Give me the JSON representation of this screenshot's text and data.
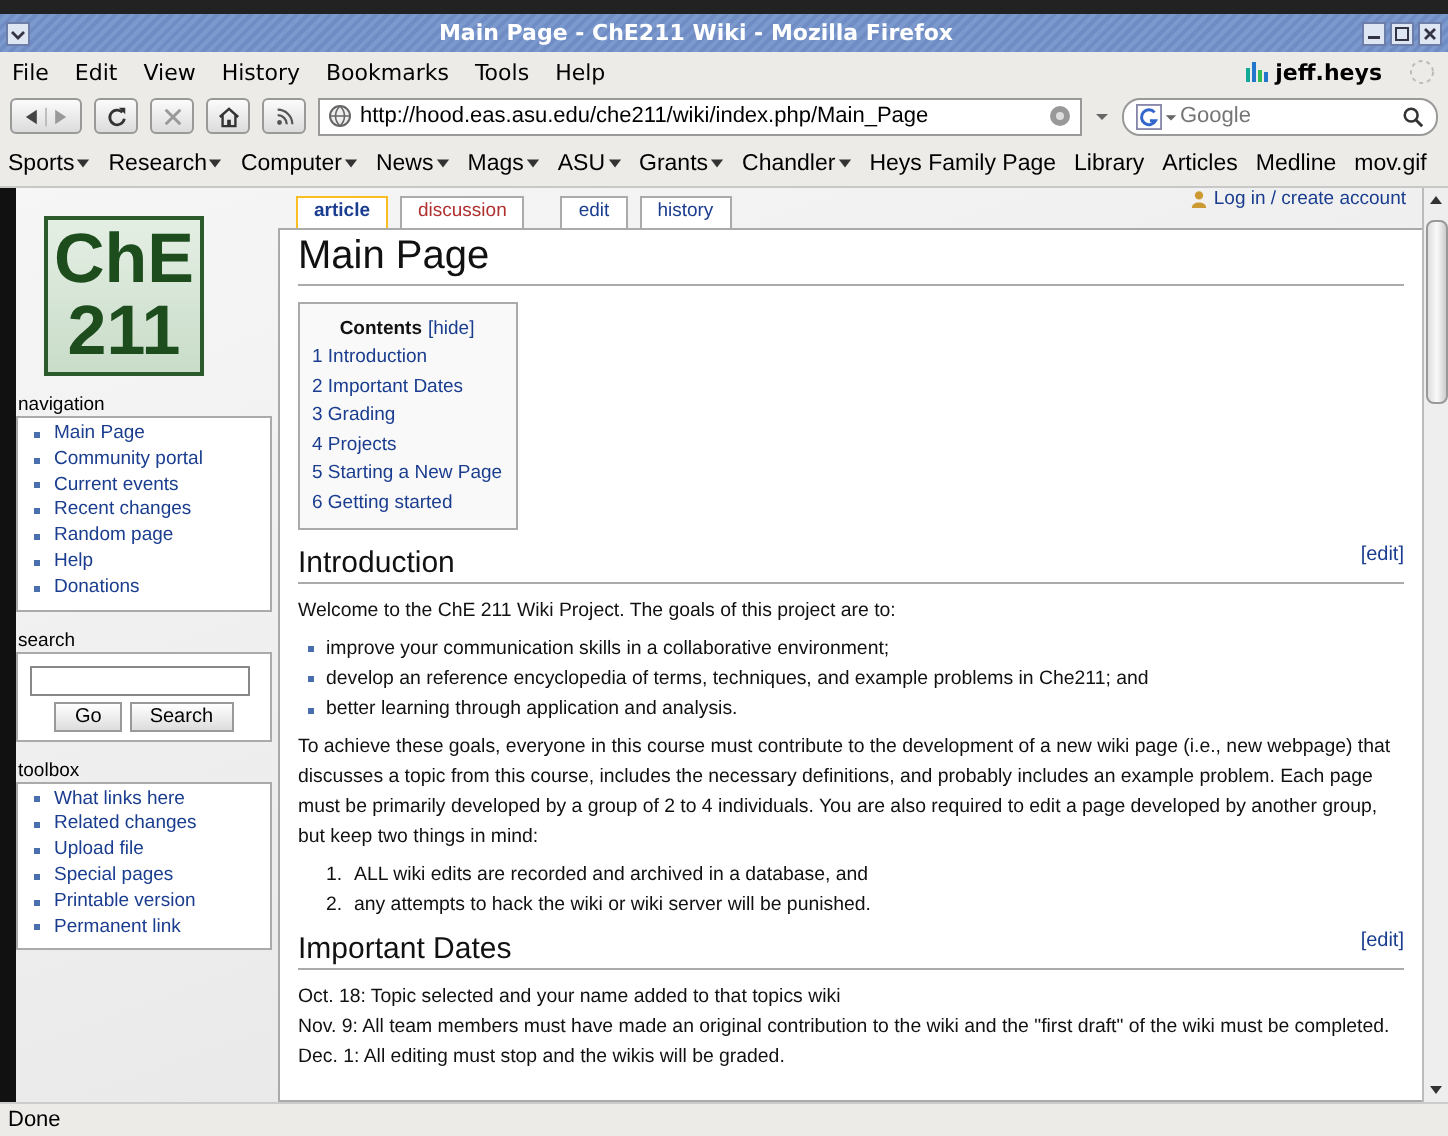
{
  "window": {
    "title": "Main Page - ChE211 Wiki - Mozilla Firefox"
  },
  "menu": [
    "File",
    "Edit",
    "View",
    "History",
    "Bookmarks",
    "Tools",
    "Help"
  ],
  "user": "jeff.heys",
  "url": "http://hood.eas.asu.edu/che211/wiki/index.php/Main_Page",
  "search_engine": {
    "placeholder": "Google"
  },
  "bookmarks": [
    {
      "label": "Sports",
      "has_menu": true
    },
    {
      "label": "Research",
      "has_menu": true
    },
    {
      "label": "Computer",
      "has_menu": true
    },
    {
      "label": "News",
      "has_menu": true
    },
    {
      "label": "Mags",
      "has_menu": true
    },
    {
      "label": "ASU",
      "has_menu": true
    },
    {
      "label": "Grants",
      "has_menu": true
    },
    {
      "label": "Chandler",
      "has_menu": true
    },
    {
      "label": "Heys Family Page",
      "has_menu": false
    },
    {
      "label": "Library",
      "has_menu": false
    },
    {
      "label": "Articles",
      "has_menu": false
    },
    {
      "label": "Medline",
      "has_menu": false
    },
    {
      "label": "mov.gif",
      "has_menu": false
    }
  ],
  "login": "Log in / create account",
  "logo": [
    "ChE",
    "211"
  ],
  "sidebar": [
    {
      "title": "navigation",
      "kind": "links",
      "items": [
        "Main Page",
        "Community portal",
        "Current events",
        "Recent changes",
        "Random page",
        "Help",
        "Donations"
      ]
    },
    {
      "title": "search",
      "kind": "search",
      "buttons": [
        "Go",
        "Search"
      ]
    },
    {
      "title": "toolbox",
      "kind": "links",
      "items": [
        "What links here",
        "Related changes",
        "Upload file",
        "Special pages",
        "Printable version",
        "Permanent link"
      ]
    }
  ],
  "tabs": [
    {
      "label": "article",
      "selected": true,
      "missing": false
    },
    {
      "label": "discussion",
      "selected": false,
      "missing": true
    },
    {
      "label": "edit",
      "selected": false,
      "missing": false
    },
    {
      "label": "history",
      "selected": false,
      "missing": false
    }
  ],
  "page_title": "Main Page",
  "toc": {
    "title": "Contents",
    "toggle": "[hide]",
    "items": [
      "1 Introduction",
      "2 Important Dates",
      "3 Grading",
      "4 Projects",
      "5 Starting a New Page",
      "6 Getting started"
    ]
  },
  "sections": [
    {
      "heading": "Introduction",
      "edit": "[edit]",
      "blocks": [
        {
          "kind": "para",
          "text": "Welcome to the ChE 211 Wiki Project. The goals of this project are to:"
        },
        {
          "kind": "bullets",
          "items": [
            "improve your communication skills in a collaborative environment;",
            "develop an reference encyclopedia of terms, techniques, and example problems in Che211; and",
            "better learning through application and analysis."
          ]
        },
        {
          "kind": "para",
          "text": "To achieve these goals, everyone in this course must contribute to the development of a new wiki page (i.e., new webpage) that discusses a topic from this course, includes the necessary definitions, and probably includes an example problem. Each page must be primarily developed by a group of 2 to 4 individuals. You are also required to edit a page developed by another group, but keep two things in mind:"
        },
        {
          "kind": "numbered",
          "items": [
            {
              "marker": "1.",
              "text": "ALL wiki edits are recorded and archived in a database, and"
            },
            {
              "marker": "2.",
              "text": "any attempts to hack the wiki or wiki server will be punished."
            }
          ]
        }
      ]
    },
    {
      "heading": "Important Dates",
      "edit": "[edit]",
      "blocks": [
        {
          "kind": "lines",
          "items": [
            "Oct. 18: Topic selected and your name added to that topics wiki",
            "Nov. 9: All team members must have made an original contribution to the wiki and the \"first draft\" of the wiki must be completed.",
            "Dec. 1: All editing must stop and the wikis will be graded."
          ]
        }
      ]
    }
  ],
  "status": "Done"
}
